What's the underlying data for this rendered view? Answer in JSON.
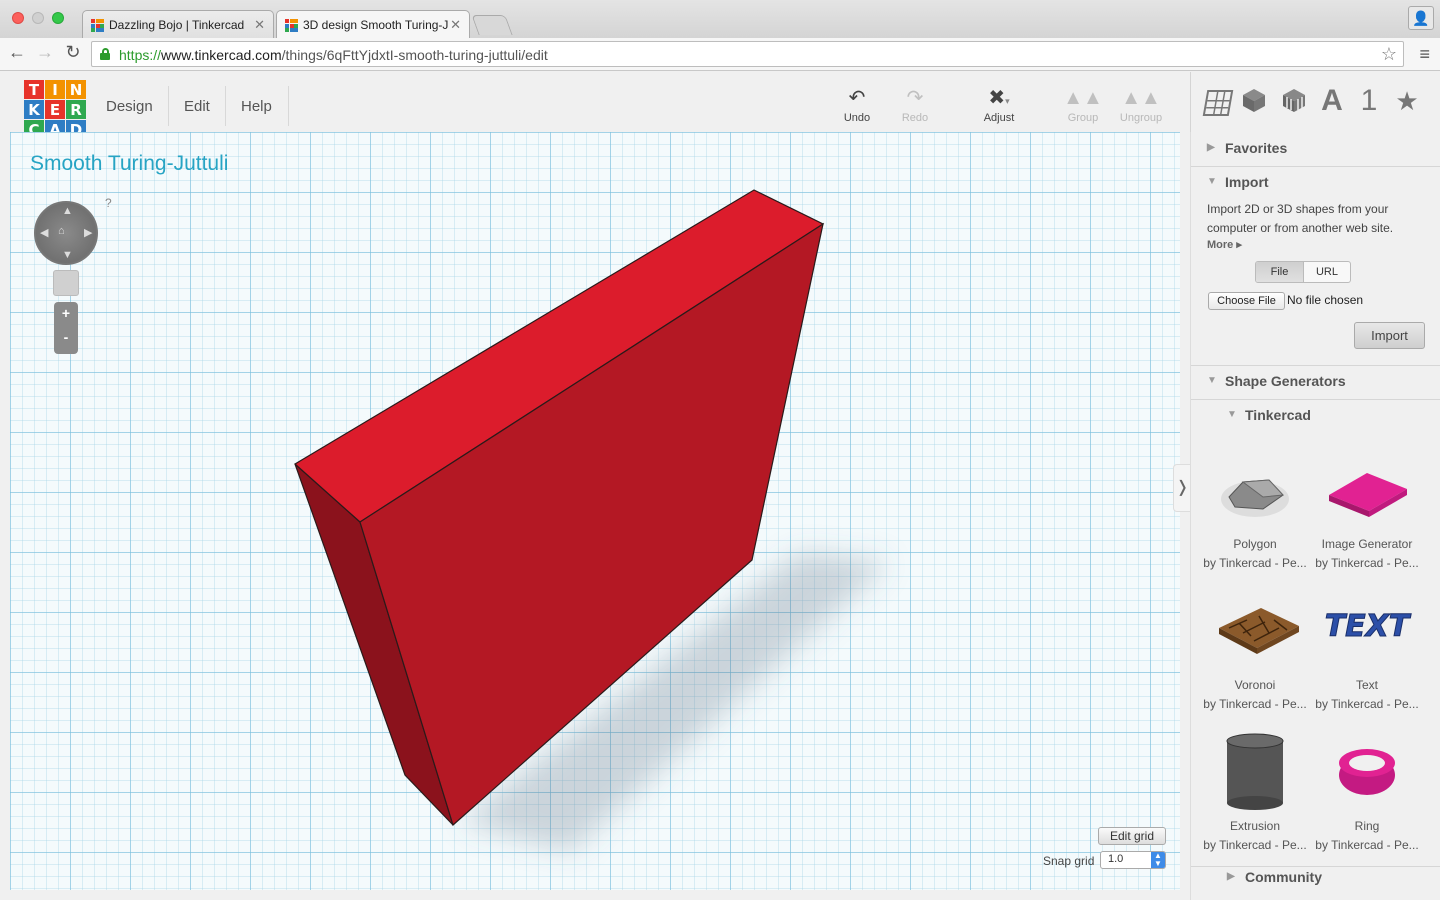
{
  "browser": {
    "tabs": [
      {
        "title": "Dazzling Bojo | Tinkercad",
        "active": false
      },
      {
        "title": "3D design Smooth Turing-J",
        "active": true
      }
    ],
    "url_scheme": "https://",
    "url_host": "www.tinkercad.com",
    "url_path": "/things/6qFttYjdxtI-smooth-turing-juttuli/edit"
  },
  "header": {
    "logo_letters": [
      "T",
      "I",
      "N",
      "K",
      "E",
      "R",
      "C",
      "A",
      "D"
    ],
    "logo_colors": [
      "#e7332a",
      "#f39200",
      "#f39200",
      "#2e7dc4",
      "#e7332a",
      "#2fa84f",
      "#2fa84f",
      "#2e7dc4",
      "#2e7dc4"
    ],
    "menu": [
      "Design",
      "Edit",
      "Help"
    ],
    "tools": {
      "undo": "Undo",
      "redo": "Redo",
      "adjust": "Adjust",
      "group": "Group",
      "ungroup": "Ungroup"
    },
    "panel_icons": {
      "letter": "A",
      "number": "1",
      "star": "★"
    }
  },
  "workplane": {
    "design_title": "Smooth Turing-Juttuli",
    "help": "?",
    "zoom_in": "+",
    "zoom_out": "-",
    "edit_grid": "Edit grid",
    "snap_grid_label": "Snap grid",
    "snap_grid_value": "1.0",
    "shape_color": "#d0202c"
  },
  "sidebar": {
    "favorites": "Favorites",
    "import": {
      "title": "Import",
      "description": "Import 2D or 3D shapes from your computer or from another web site.",
      "more": "More",
      "tab_file": "File",
      "tab_url": "URL",
      "choose_file": "Choose File",
      "no_file": "No file chosen",
      "button": "Import"
    },
    "shape_generators": "Shape Generators",
    "tinkercad": "Tinkercad",
    "shapes": [
      {
        "name": "Polygon",
        "by": "by Tinkercad - Pe..."
      },
      {
        "name": "Image Generator",
        "by": "by Tinkercad - Pe..."
      },
      {
        "name": "Voronoi",
        "by": "by Tinkercad - Pe..."
      },
      {
        "name": "Text",
        "by": "by Tinkercad - Pe..."
      },
      {
        "name": "Extrusion",
        "by": "by Tinkercad - Pe..."
      },
      {
        "name": "Ring",
        "by": "by Tinkercad - Pe..."
      }
    ],
    "community": "Community"
  }
}
